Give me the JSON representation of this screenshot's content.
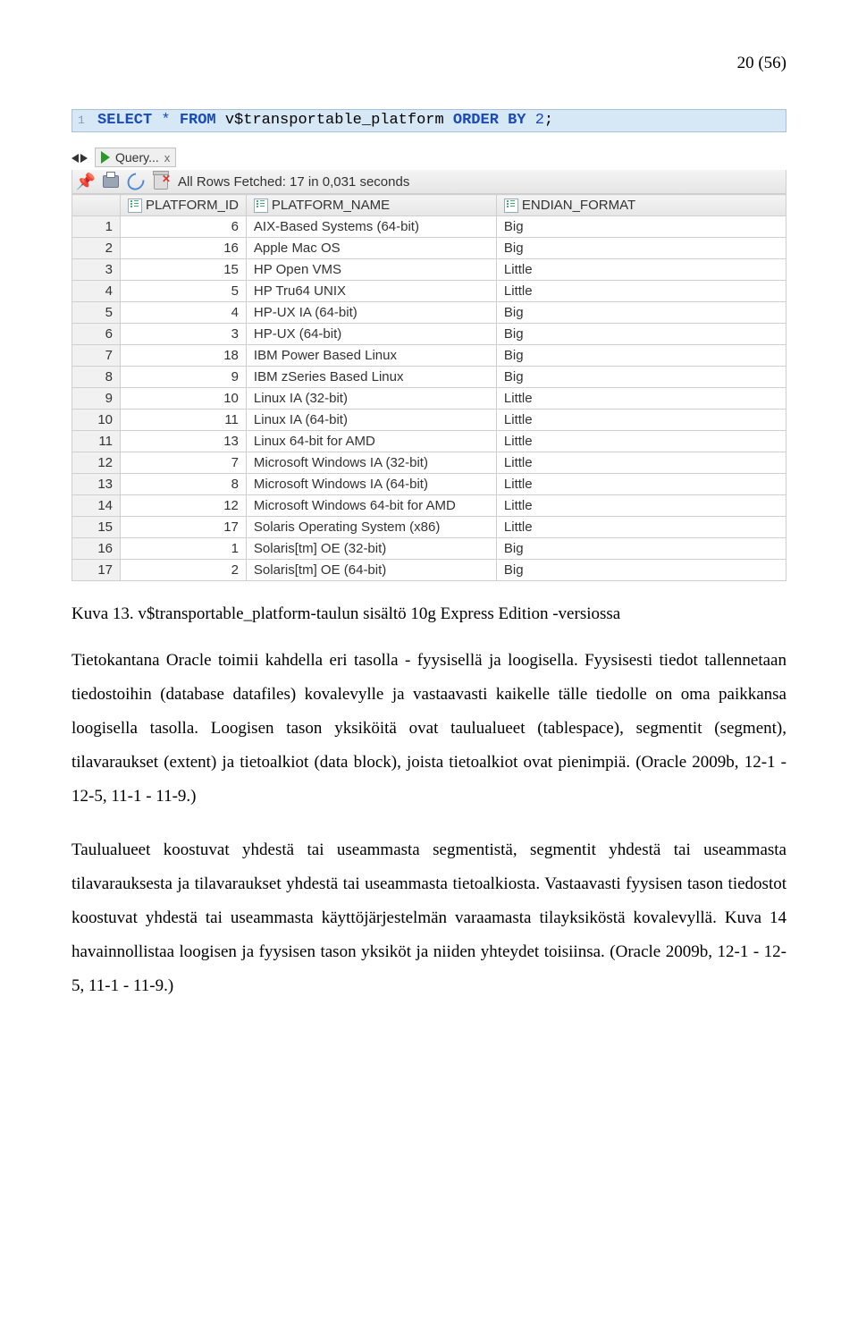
{
  "page_number": "20 (56)",
  "sql": {
    "kw_select": "SELECT",
    "star": "*",
    "kw_from": "FROM",
    "table": "v$transportable_platform",
    "kw_order": "ORDER",
    "kw_by": "BY",
    "num": "2",
    "semi": ";"
  },
  "tab": {
    "label": "Query...",
    "close": "x"
  },
  "status": "All Rows Fetched: 17 in 0,031 seconds",
  "headers": {
    "rownum": "",
    "c1": "PLATFORM_ID",
    "c2": "PLATFORM_NAME",
    "c3": "ENDIAN_FORMAT"
  },
  "rows": [
    {
      "n": "1",
      "pid": "6",
      "name": "AIX-Based Systems (64-bit)",
      "ef": "Big"
    },
    {
      "n": "2",
      "pid": "16",
      "name": "Apple Mac OS",
      "ef": "Big"
    },
    {
      "n": "3",
      "pid": "15",
      "name": "HP Open VMS",
      "ef": "Little"
    },
    {
      "n": "4",
      "pid": "5",
      "name": "HP Tru64 UNIX",
      "ef": "Little"
    },
    {
      "n": "5",
      "pid": "4",
      "name": "HP-UX IA (64-bit)",
      "ef": "Big"
    },
    {
      "n": "6",
      "pid": "3",
      "name": "HP-UX (64-bit)",
      "ef": "Big"
    },
    {
      "n": "7",
      "pid": "18",
      "name": "IBM Power Based Linux",
      "ef": "Big"
    },
    {
      "n": "8",
      "pid": "9",
      "name": "IBM zSeries Based Linux",
      "ef": "Big"
    },
    {
      "n": "9",
      "pid": "10",
      "name": "Linux IA (32-bit)",
      "ef": "Little"
    },
    {
      "n": "10",
      "pid": "11",
      "name": "Linux IA (64-bit)",
      "ef": "Little"
    },
    {
      "n": "11",
      "pid": "13",
      "name": "Linux 64-bit for AMD",
      "ef": "Little"
    },
    {
      "n": "12",
      "pid": "7",
      "name": "Microsoft Windows IA (32-bit)",
      "ef": "Little"
    },
    {
      "n": "13",
      "pid": "8",
      "name": "Microsoft Windows IA (64-bit)",
      "ef": "Little"
    },
    {
      "n": "14",
      "pid": "12",
      "name": "Microsoft Windows 64-bit for AMD",
      "ef": "Little"
    },
    {
      "n": "15",
      "pid": "17",
      "name": "Solaris Operating System (x86)",
      "ef": "Little"
    },
    {
      "n": "16",
      "pid": "1",
      "name": "Solaris[tm] OE (32-bit)",
      "ef": "Big"
    },
    {
      "n": "17",
      "pid": "2",
      "name": "Solaris[tm] OE (64-bit)",
      "ef": "Big"
    }
  ],
  "caption": "Kuva 13. v$transportable_platform-taulun sisältö 10g Express Edition -versiossa",
  "para1": "Tietokantana Oracle toimii kahdella eri tasolla - fyysisellä ja loogisella. Fyysisesti tiedot tallennetaan tiedostoihin (database datafiles) kovalevylle ja vastaavasti kaikelle tälle tiedolle on oma paikkansa loogisella tasolla. Loogisen tason yksiköitä ovat taulualueet (tablespace), segmentit (segment), tilavaraukset (extent) ja tietoalkiot (data block), joista tietoalkiot ovat pienimpiä. (Oracle 2009b, 12-1 - 12-5, 11-1 - 11-9.)",
  "para2": "Taulualueet koostuvat yhdestä tai useammasta segmentistä, segmentit yhdestä tai useammasta tilavarauksesta ja tilavaraukset yhdestä tai useammasta tietoalkiosta. Vastaavasti fyysisen tason tiedostot koostuvat yhdestä tai useammasta käyttöjärjestelmän varaamasta tilayksiköstä kovalevyllä. Kuva 14 havainnollistaa loogisen ja fyysisen tason yksiköt ja niiden yhteydet toisiinsa. (Oracle 2009b, 12-1 - 12-5, 11-1 - 11-9.)"
}
